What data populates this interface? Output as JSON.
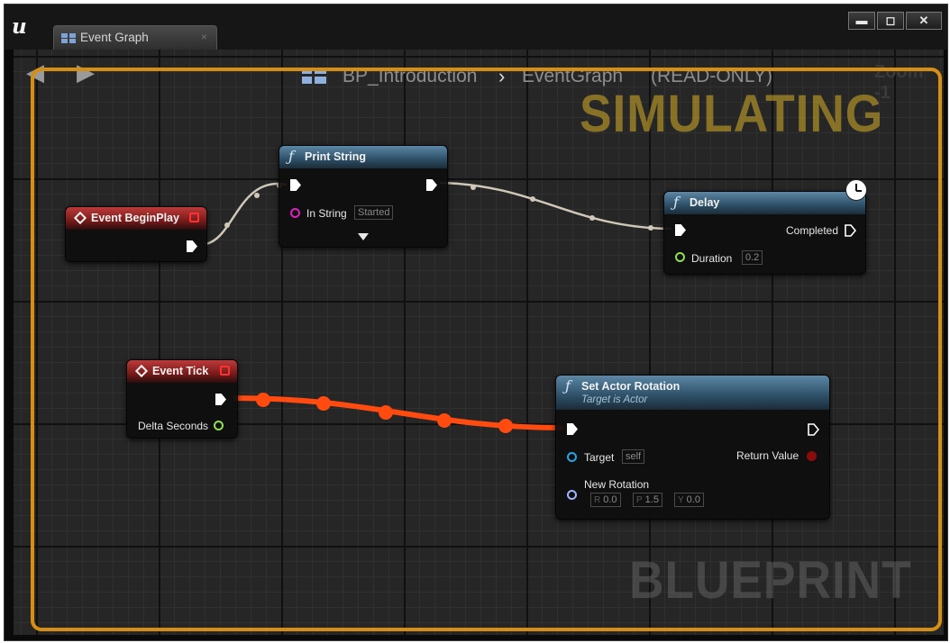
{
  "window": {
    "logo": "u",
    "tab_label": "Event Graph",
    "tab_close": "×",
    "controls": {
      "minimize": "▬",
      "maximize": "◻",
      "close": "✕"
    }
  },
  "toolbar": {
    "back_icon": "arrow-left-icon",
    "forward_icon": "arrow-right-icon",
    "blueprint_name": "BP_Introduction",
    "separator": "›",
    "graph_name": "EventGraph",
    "mode": "(READ-ONLY)",
    "zoom_label": "Zoom -1"
  },
  "overlay": {
    "simulating_label": "SIMULATING",
    "watermark": "BLUEPRINT",
    "border_color": "#d68f12"
  },
  "nodes": {
    "event_begin_play": {
      "title": "Event BeginPlay"
    },
    "print_string": {
      "title": "Print String",
      "in_string_label": "In String",
      "in_string_value": "Started"
    },
    "delay": {
      "title": "Delay",
      "completed_label": "Completed",
      "duration_label": "Duration",
      "duration_value": "0.2"
    },
    "event_tick": {
      "title": "Event Tick",
      "delta_label": "Delta Seconds"
    },
    "set_actor_rotation": {
      "title": "Set Actor Rotation",
      "subtitle": "Target is Actor",
      "target_label": "Target",
      "target_value": "self",
      "return_label": "Return Value",
      "rotation_label": "New Rotation",
      "rotation": {
        "r_prefix": "R",
        "r": "0.0",
        "p_prefix": "P",
        "p": "1.5",
        "y_prefix": "Y",
        "y": "0.0"
      }
    }
  },
  "colors": {
    "event_header": "#bd3a3a",
    "function_header": "#5c87a6",
    "active_wire": "#ff4a10",
    "idle_wire": "#cfc7b8",
    "string_pin": "#e020c0",
    "float_pin": "#8fe050",
    "object_pin": "#25a7e6",
    "rotator_pin": "#a0b4ff",
    "bool_pin": "#8a0c0c"
  }
}
